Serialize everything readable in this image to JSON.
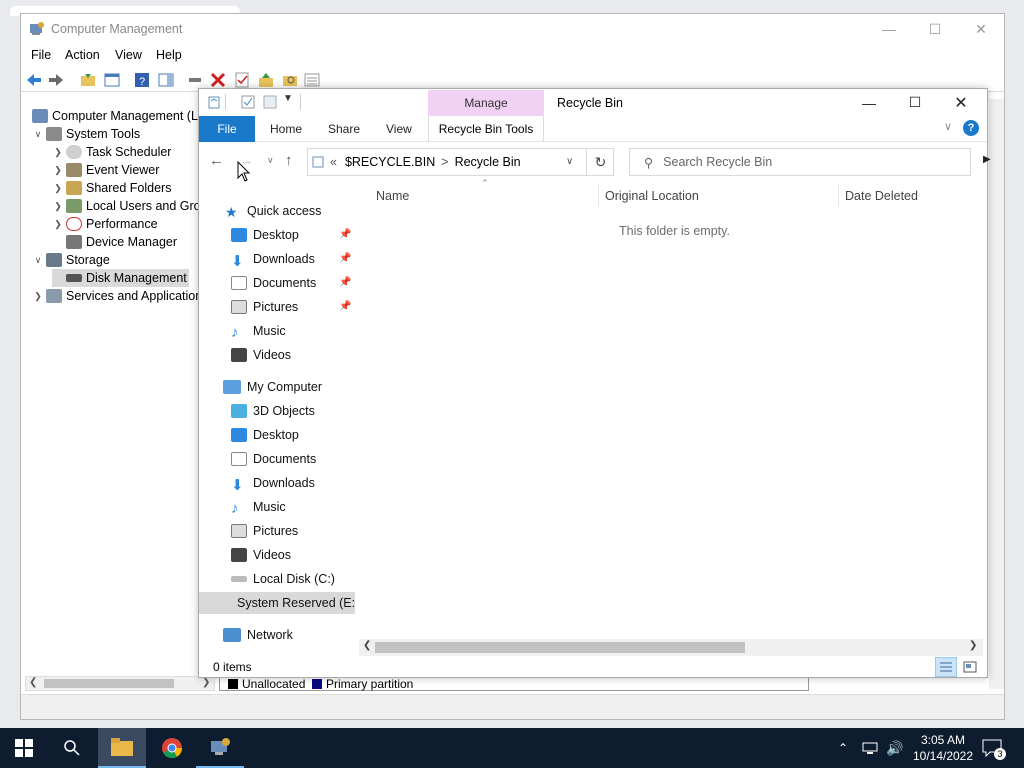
{
  "computer_management": {
    "title": "Computer Management",
    "menu": [
      "File",
      "Action",
      "View",
      "Help"
    ],
    "tree": [
      {
        "label": "Computer Management (Lo",
        "level": 0,
        "expander": ""
      },
      {
        "label": "System Tools",
        "level": 1,
        "expander": "v"
      },
      {
        "label": "Task Scheduler",
        "level": 2,
        "expander": ">"
      },
      {
        "label": "Event Viewer",
        "level": 2,
        "expander": ">"
      },
      {
        "label": "Shared Folders",
        "level": 2,
        "expander": ">"
      },
      {
        "label": "Local Users and Grou",
        "level": 2,
        "expander": ">"
      },
      {
        "label": "Performance",
        "level": 2,
        "expander": ">"
      },
      {
        "label": "Device Manager",
        "level": 2,
        "expander": ""
      },
      {
        "label": "Storage",
        "level": 1,
        "expander": "v"
      },
      {
        "label": "Disk Management",
        "level": 2,
        "expander": ""
      },
      {
        "label": "Services and Application",
        "level": 1,
        "expander": ">"
      }
    ],
    "legend": {
      "unallocated": "Unallocated",
      "primary": "Primary partition"
    }
  },
  "explorer": {
    "title": "Recycle Bin",
    "manage_tab": "Manage",
    "ribbon_tabs": [
      "File",
      "Home",
      "Share",
      "View"
    ],
    "contextual_tab": "Recycle Bin Tools",
    "address": {
      "prefix": "«",
      "segment1": "$RECYCLE.BIN",
      "separator": ">",
      "segment2": "Recycle Bin"
    },
    "search_placeholder": "Search Recycle Bin",
    "columns": [
      "Name",
      "Original Location",
      "Date Deleted"
    ],
    "empty_message": "This folder is empty.",
    "status": "0 items",
    "quick_access_label": "Quick access",
    "quick_access": [
      "Desktop",
      "Downloads",
      "Documents",
      "Pictures",
      "Music",
      "Videos"
    ],
    "my_computer_label": "My Computer",
    "my_computer": [
      "3D Objects",
      "Desktop",
      "Documents",
      "Downloads",
      "Music",
      "Pictures",
      "Videos",
      "Local Disk (C:)",
      "System Reserved (E:"
    ],
    "network_label": "Network"
  },
  "taskbar": {
    "time": "3:05 AM",
    "date": "10/14/2022",
    "notification_count": "3"
  },
  "colors": {
    "file_tab": "#1979ca",
    "manage_tab": "#f1d2f5",
    "taskbar": "#0e1c2f",
    "selected_row": "#d9d9d9"
  }
}
